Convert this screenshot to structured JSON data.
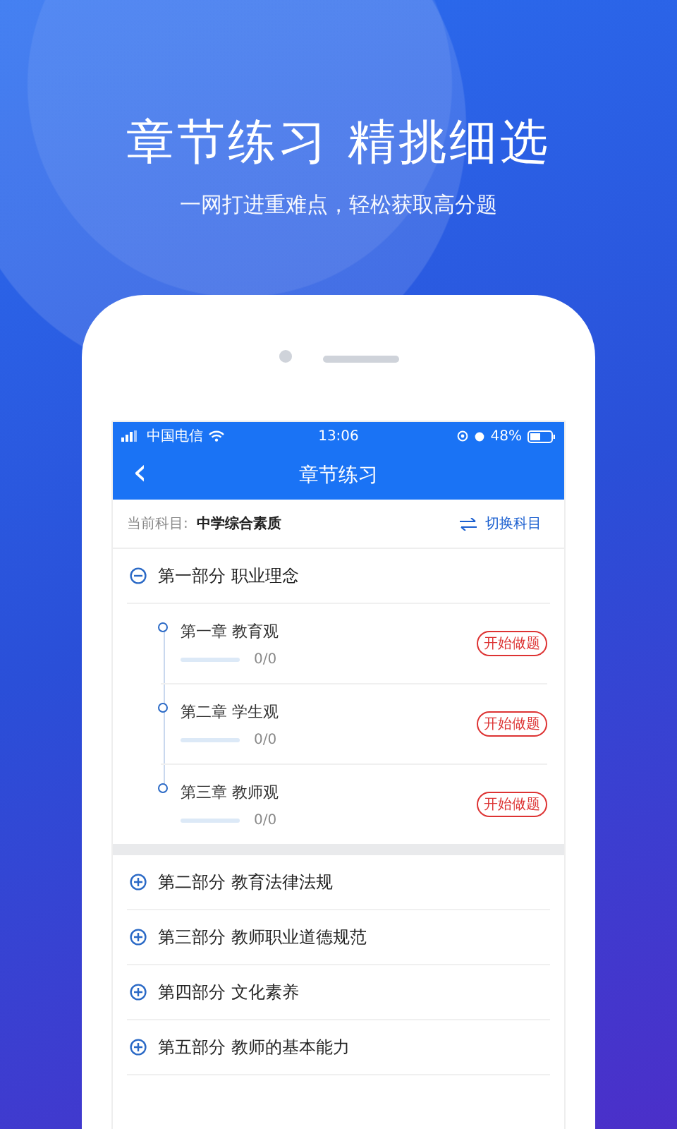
{
  "headline": "章节练习 精挑细选",
  "subtitle": "一网打进重难点，轻松获取高分题",
  "status_bar": {
    "carrier": "中国电信",
    "time": "13:06",
    "battery": "48%"
  },
  "nav_bar": {
    "back": "‹",
    "title": "章节练习"
  },
  "subject_bar": {
    "label": "当前科目:",
    "subject": "中学综合素质",
    "switch": "切换科目"
  },
  "parts": [
    {
      "title": "第一部分 职业理念",
      "expanded": true,
      "children": [
        {
          "title": "第一章 教育观",
          "level": 0,
          "count": "0/0",
          "action": "开始做题"
        },
        {
          "title": "第二章 学生观",
          "level": 0,
          "count": "0/0",
          "action": "开始做题"
        },
        {
          "title": "第三章 教师观",
          "level": 0,
          "count": "0/0",
          "action": "开始做题"
        }
      ]
    },
    {
      "title": "第二部分 教育法律法规",
      "expanded": false
    },
    {
      "title": "第三部分 教师职业道德规范",
      "expanded": false
    },
    {
      "title": "第四部分 文化素养",
      "expanded": false
    },
    {
      "title": "第五部分 教师的基本能力",
      "expanded": false
    }
  ]
}
